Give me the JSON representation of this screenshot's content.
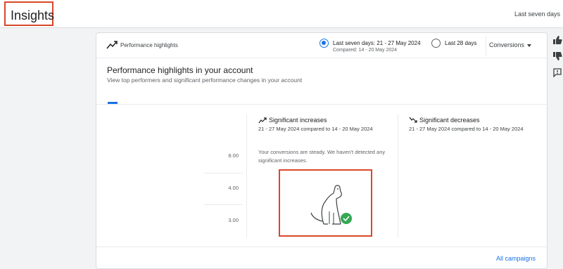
{
  "header": {
    "page_title": "Insights",
    "date_range_label": "Last seven days"
  },
  "card": {
    "title": "Performance highlights",
    "options": {
      "last_seven": {
        "label": "Last seven days: 21 - 27 May 2024",
        "compared": "Compared: 14 - 20 May 2024",
        "selected": true
      },
      "last_28": {
        "label": "Last 28 days",
        "selected": false
      }
    },
    "metric_dropdown": "Conversions",
    "heading": "Performance highlights in your account",
    "subheading": "View top performers and significant performance changes in your account",
    "chart_ticks": [
      "8.00",
      "4.00",
      "3.00"
    ],
    "increases": {
      "title": "Significant increases",
      "dates": "21 - 27 May 2024 compared to 14 - 20 May 2024",
      "message": "Your conversions are steady. We haven't detected any significant increases."
    },
    "decreases": {
      "title": "Significant decreases",
      "dates": "21 - 27 May 2024 compared to 14 - 20 May 2024"
    },
    "footer_link": "All campaigns"
  },
  "colors": {
    "accent": "#1a73e8",
    "highlight_border": "#d9472b",
    "success": "#34a853"
  }
}
